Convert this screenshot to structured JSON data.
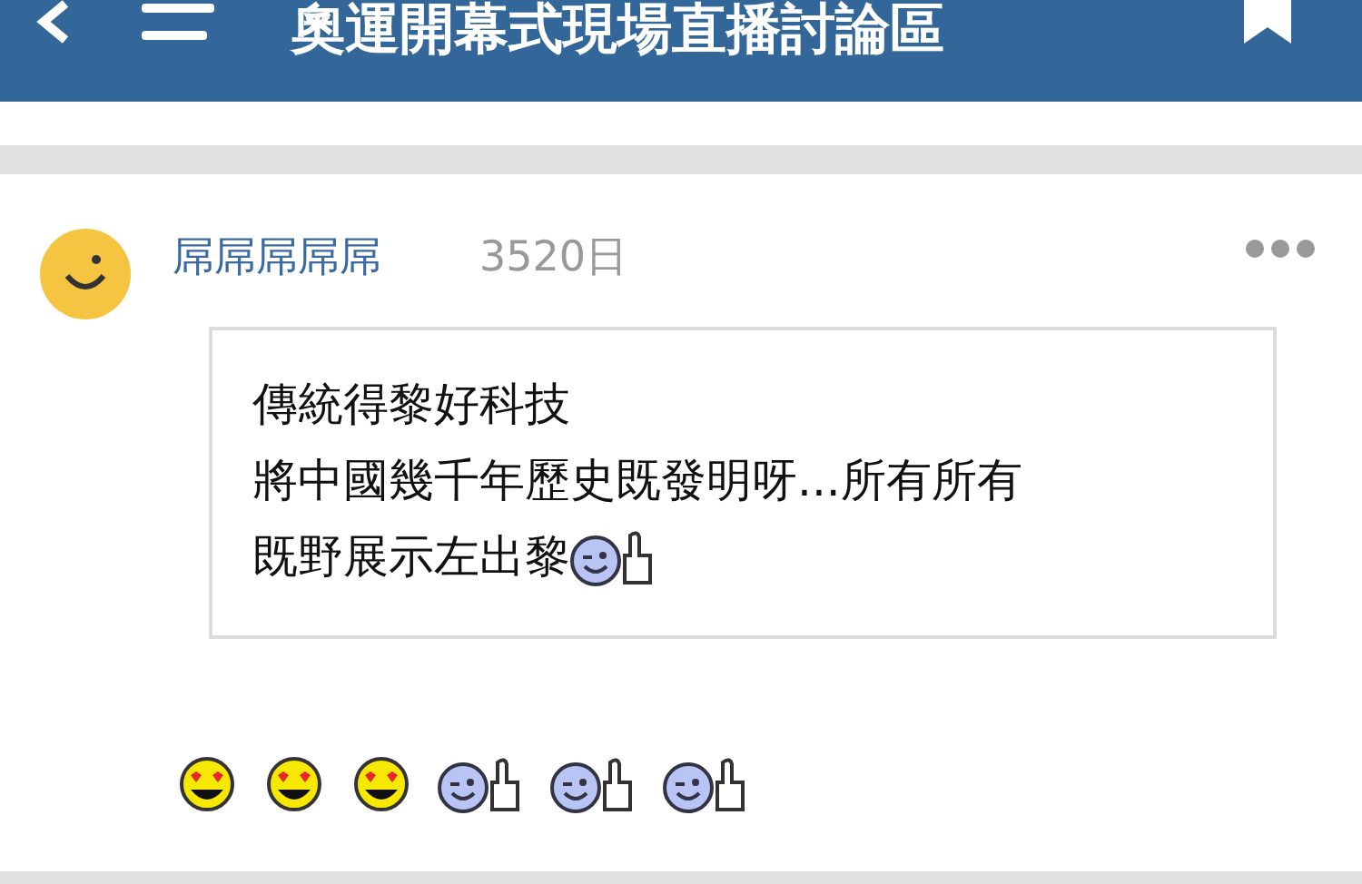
{
  "header": {
    "title": "奧運開幕式現場直播討論區"
  },
  "post": {
    "author": "屌屌屌屌屌",
    "age": "3520日",
    "quote": {
      "lines": [
        "傳統得黎好科技",
        "將中國幾千年歷史既發明呀...所有所有",
        "既野展示左出黎"
      ],
      "end_emoticon": {
        "kind": "thumbs-up"
      }
    },
    "emoticons": [
      {
        "kind": "heart-eyes"
      },
      {
        "kind": "heart-eyes"
      },
      {
        "kind": "heart-eyes"
      },
      {
        "kind": "thumbs-up"
      },
      {
        "kind": "thumbs-up"
      },
      {
        "kind": "thumbs-up"
      }
    ]
  }
}
